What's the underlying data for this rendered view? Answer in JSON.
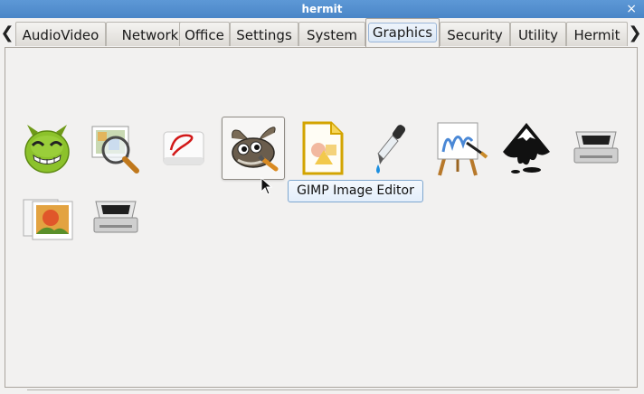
{
  "window": {
    "title": "hermit",
    "close_glyph": "×"
  },
  "nav": {
    "left_arrow": "❮",
    "right_arrow": "❯"
  },
  "tabs": [
    {
      "label": "AudioVideo"
    },
    {
      "label": "Network"
    },
    {
      "label": "Office"
    },
    {
      "label": "Settings"
    },
    {
      "label": "System"
    },
    {
      "label": "Graphics",
      "active": true
    },
    {
      "label": "Security"
    },
    {
      "label": "Utility"
    },
    {
      "label": "Hermit"
    }
  ],
  "apps": [
    {
      "icon": "green-monster-icon"
    },
    {
      "icon": "image-viewer-magnifier-icon"
    },
    {
      "icon": "pdf-reader-icon"
    },
    {
      "icon": "gimp-icon",
      "hovered": true
    },
    {
      "icon": "libreoffice-draw-icon"
    },
    {
      "icon": "color-picker-dropper-icon"
    },
    {
      "icon": "painting-easel-icon"
    },
    {
      "icon": "inkscape-icon"
    },
    {
      "icon": "scanner-icon"
    },
    {
      "icon": "photo-gallery-icon"
    },
    {
      "icon": "scanner-icon"
    }
  ],
  "tooltip": {
    "text": "GIMP Image Editor"
  }
}
